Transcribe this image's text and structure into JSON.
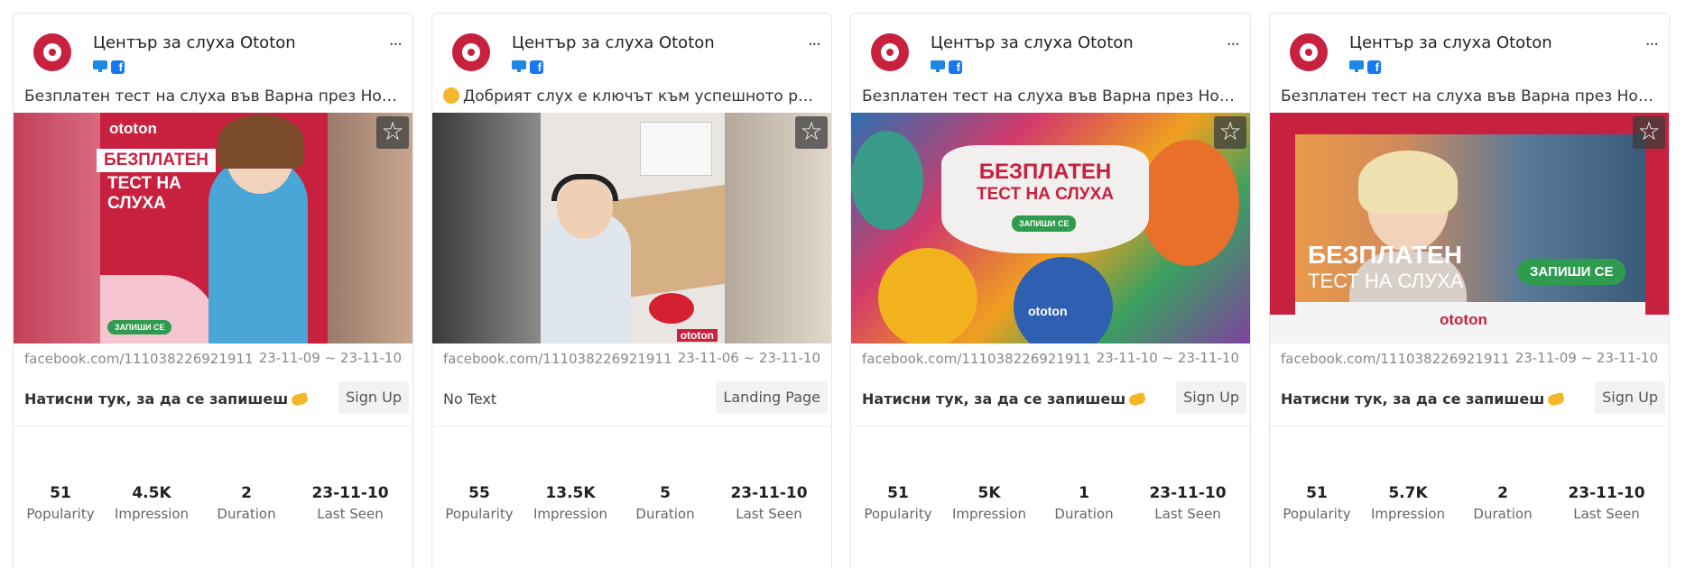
{
  "cards": [
    {
      "advertiser": "Център за слуха Ototon",
      "caption": "Безплатен тест на слуха във Варна през Ноем...",
      "domain": "facebook.com/111038226921911",
      "dates": "23-11-09 ~ 23-11-10",
      "cta_text": "Натисни тук, за да се запишеш",
      "cta_button": "Sign Up",
      "stats": [
        {
          "value": "51",
          "label": "Popularity"
        },
        {
          "value": "4.5K",
          "label": "Impression"
        },
        {
          "value": "2",
          "label": "Duration"
        },
        {
          "value": "23-11-10",
          "label": "Last Seen"
        }
      ],
      "creative": {
        "brand": "ototon",
        "headline1": "БЕЗПЛАТЕН",
        "headline2": "ТЕСТ НА",
        "headline3": "СЛУХА",
        "cta": "ЗАПИШИ СЕ"
      }
    },
    {
      "advertiser": "Център за слуха Ototon",
      "caption": "Добрият слух е ключът към успешното раз...",
      "domain": "facebook.com/111038226921911",
      "dates": "23-11-06 ~ 23-11-10",
      "cta_text": "No Text",
      "cta_button": "Landing Page",
      "stats": [
        {
          "value": "55",
          "label": "Popularity"
        },
        {
          "value": "13.5K",
          "label": "Impression"
        },
        {
          "value": "5",
          "label": "Duration"
        },
        {
          "value": "23-11-10",
          "label": "Last Seen"
        }
      ],
      "creative": {
        "brand": "ototon"
      }
    },
    {
      "advertiser": "Център за слуха Ototon",
      "caption": "Безплатен тест на слуха във Варна през Ноем...",
      "domain": "facebook.com/111038226921911",
      "dates": "23-11-10 ~ 23-11-10",
      "cta_text": "Натисни тук, за да се запишеш",
      "cta_button": "Sign Up",
      "stats": [
        {
          "value": "51",
          "label": "Popularity"
        },
        {
          "value": "5K",
          "label": "Impression"
        },
        {
          "value": "1",
          "label": "Duration"
        },
        {
          "value": "23-11-10",
          "label": "Last Seen"
        }
      ],
      "creative": {
        "brand": "ototon",
        "headline1": "БЕЗПЛАТЕН",
        "headline2": "ТЕСТ НА СЛУХА",
        "cta": "ЗАПИШИ СЕ"
      }
    },
    {
      "advertiser": "Център за слуха Ototon",
      "caption": "Безплатен тест на слуха във Варна през Ноем...",
      "domain": "facebook.com/111038226921911",
      "dates": "23-11-09 ~ 23-11-10",
      "cta_text": "Натисни тук, за да се запишеш",
      "cta_button": "Sign Up",
      "stats": [
        {
          "value": "51",
          "label": "Popularity"
        },
        {
          "value": "5.7K",
          "label": "Impression"
        },
        {
          "value": "2",
          "label": "Duration"
        },
        {
          "value": "23-11-10",
          "label": "Last Seen"
        }
      ],
      "creative": {
        "brand": "ototon",
        "headline1": "БЕЗПЛАТЕН",
        "headline2": "ТЕСТ НА СЛУХА",
        "cta": "ЗАПИШИ СЕ"
      }
    }
  ],
  "colors": {
    "brand_red": "#c8203f",
    "facebook_blue": "#1877f2",
    "desktop_blue": "#1e88e5",
    "cta_green": "#2e9b4e"
  },
  "icons": {
    "more": "more-horizontal-icon",
    "favorite": "star-outline-icon",
    "desktop": "desktop-icon",
    "facebook": "facebook-icon"
  }
}
